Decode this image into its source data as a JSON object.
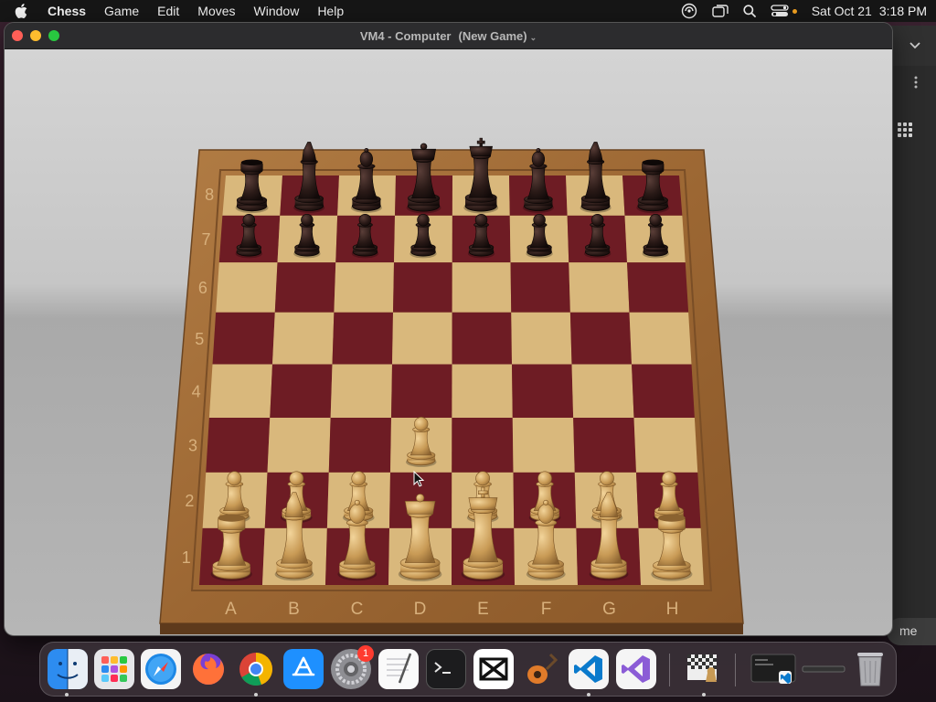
{
  "menubar": {
    "app_name": "Chess",
    "items": [
      "Game",
      "Edit",
      "Moves",
      "Window",
      "Help"
    ],
    "date": "Sat Oct 21",
    "time": "3:18 PM"
  },
  "window": {
    "title": "VM4 - Computer",
    "subtitle": "(New Game)"
  },
  "background_window": {
    "button_fragment": "me"
  },
  "board": {
    "files": [
      "A",
      "B",
      "C",
      "D",
      "E",
      "F",
      "G",
      "H"
    ],
    "ranks": [
      "1",
      "2",
      "3",
      "4",
      "5",
      "6",
      "7",
      "8"
    ],
    "light_square": "#d9b87c",
    "dark_square": "#6e1c24",
    "frame_color": "#a8743c",
    "white_piece_color": "#c89a55",
    "black_piece_color": "#2a1a17",
    "pieces": [
      {
        "square": "a8",
        "type": "rook",
        "color": "black"
      },
      {
        "square": "b8",
        "type": "knight",
        "color": "black"
      },
      {
        "square": "c8",
        "type": "bishop",
        "color": "black"
      },
      {
        "square": "d8",
        "type": "queen",
        "color": "black"
      },
      {
        "square": "e8",
        "type": "king",
        "color": "black"
      },
      {
        "square": "f8",
        "type": "bishop",
        "color": "black"
      },
      {
        "square": "g8",
        "type": "knight",
        "color": "black"
      },
      {
        "square": "h8",
        "type": "rook",
        "color": "black"
      },
      {
        "square": "a7",
        "type": "pawn",
        "color": "black"
      },
      {
        "square": "b7",
        "type": "pawn",
        "color": "black"
      },
      {
        "square": "c7",
        "type": "pawn",
        "color": "black"
      },
      {
        "square": "d7",
        "type": "pawn",
        "color": "black"
      },
      {
        "square": "e7",
        "type": "pawn",
        "color": "black"
      },
      {
        "square": "f7",
        "type": "pawn",
        "color": "black"
      },
      {
        "square": "g7",
        "type": "pawn",
        "color": "black"
      },
      {
        "square": "h7",
        "type": "pawn",
        "color": "black"
      },
      {
        "square": "d3",
        "type": "pawn",
        "color": "white"
      },
      {
        "square": "a2",
        "type": "pawn",
        "color": "white"
      },
      {
        "square": "b2",
        "type": "pawn",
        "color": "white"
      },
      {
        "square": "c2",
        "type": "pawn",
        "color": "white"
      },
      {
        "square": "e2",
        "type": "pawn",
        "color": "white"
      },
      {
        "square": "f2",
        "type": "pawn",
        "color": "white"
      },
      {
        "square": "g2",
        "type": "pawn",
        "color": "white"
      },
      {
        "square": "h2",
        "type": "pawn",
        "color": "white"
      },
      {
        "square": "a1",
        "type": "rook",
        "color": "white"
      },
      {
        "square": "b1",
        "type": "knight",
        "color": "white"
      },
      {
        "square": "c1",
        "type": "bishop",
        "color": "white"
      },
      {
        "square": "d1",
        "type": "queen",
        "color": "white"
      },
      {
        "square": "e1",
        "type": "king",
        "color": "white"
      },
      {
        "square": "f1",
        "type": "bishop",
        "color": "white"
      },
      {
        "square": "g1",
        "type": "knight",
        "color": "white"
      },
      {
        "square": "h1",
        "type": "rook",
        "color": "white"
      }
    ]
  },
  "dock": {
    "apps": [
      {
        "name": "Finder",
        "icon": "finder-icon",
        "running": true
      },
      {
        "name": "Launchpad",
        "icon": "launchpad-icon",
        "running": false
      },
      {
        "name": "Safari",
        "icon": "safari-icon",
        "running": false
      },
      {
        "name": "Firefox",
        "icon": "firefox-icon",
        "running": false
      },
      {
        "name": "Chrome",
        "icon": "chrome-icon",
        "running": true
      },
      {
        "name": "App Store",
        "icon": "app-store-icon",
        "running": false
      },
      {
        "name": "System Settings",
        "icon": "settings-icon",
        "running": false,
        "badge": "1"
      },
      {
        "name": "TextEdit",
        "icon": "textedit-icon",
        "running": false
      },
      {
        "name": "Terminal",
        "icon": "terminal-icon",
        "running": false
      },
      {
        "name": "CapCut",
        "icon": "capcut-icon",
        "running": false
      },
      {
        "name": "GarageBand",
        "icon": "garageband-icon",
        "running": false
      },
      {
        "name": "VS Code",
        "icon": "vscode-icon",
        "running": true
      },
      {
        "name": "Visual Studio",
        "icon": "visual-studio-icon",
        "running": false
      },
      {
        "name": "Chess",
        "icon": "chess-icon",
        "running": true
      },
      {
        "name": "Window preview",
        "icon": "window-preview-icon",
        "running": false
      },
      {
        "name": "Minimized window",
        "icon": "minimized-window-icon",
        "running": false
      },
      {
        "name": "Trash",
        "icon": "trash-icon",
        "running": false
      }
    ],
    "badge_color": "#ff3b30"
  }
}
